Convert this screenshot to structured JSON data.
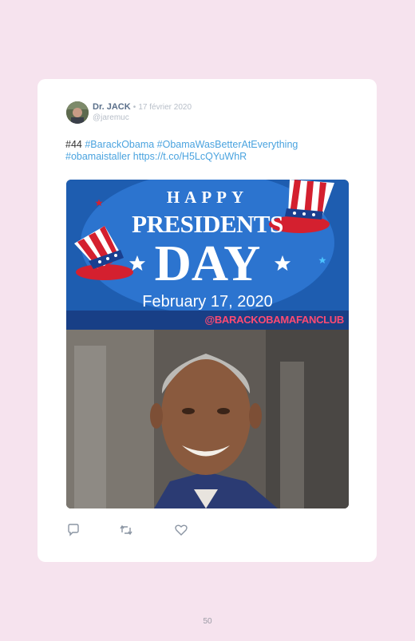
{
  "tweet": {
    "author_name": "Dr. JACK",
    "separator": "•",
    "date": "17 février 2020",
    "handle": "@jaremuc",
    "text_prefix": "#44",
    "hashtags_line1": "#BarackObama #ObamaWasBetterAtEverything",
    "hashtags_line2": "#obamaistaller",
    "link": "https://t.co/H5LcQYuWhR"
  },
  "image": {
    "happy": "HAPPY",
    "presidents": "PRESIDENTS",
    "day": "DAY",
    "date": "February 17, 2020",
    "watermark": "@BARACKOBAMAFANCLUB"
  },
  "actions": {
    "reply_icon": "reply-icon",
    "retweet_icon": "retweet-icon",
    "like_icon": "heart-icon"
  },
  "page_number": "50",
  "colors": {
    "background": "#f6e3ee",
    "link": "#4aa3df",
    "banner_blue": "#1e5db0"
  }
}
